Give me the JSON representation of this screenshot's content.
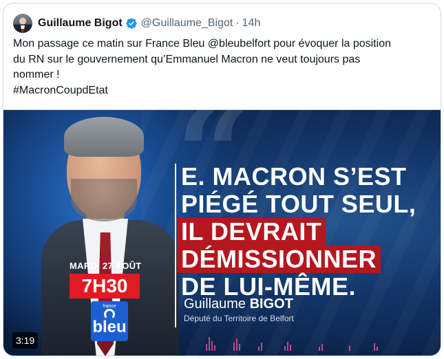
{
  "tweet": {
    "author_name": "Guillaume Bigot",
    "handle": "@Guillaume_Bigot",
    "separator": "·",
    "time": "14h",
    "text_lines": [
      "Mon passage ce matin sur France Bleu @bleubelfort pour évoquer la position",
      "du RN sur le gouvernement qu’Emmanuel Macron ne veut toujours pas",
      "nommer !",
      "#MacronCoupdEtat"
    ]
  },
  "media": {
    "headline_lines": [
      "E. MACRON S’EST",
      "PIÉGÉ TOUT SEUL,"
    ],
    "headline_red_lines": [
      "IL DEVRAIT",
      "DÉMISSIONNER"
    ],
    "headline_last_line": "DE LUI-MÊME.",
    "speaker_first": "Guillaume",
    "speaker_last": "BIGOT",
    "speaker_role": "Député du Territoire de Belfort",
    "date": "MARDI 27 AOÛT",
    "time": "7H30",
    "logo_small": "france",
    "logo_text": "bleu",
    "duration": "3:19"
  },
  "icons": {
    "verified": "verified-badge-icon",
    "brand_blue": "#1d9bf0",
    "accent_red": "#e21b23"
  }
}
